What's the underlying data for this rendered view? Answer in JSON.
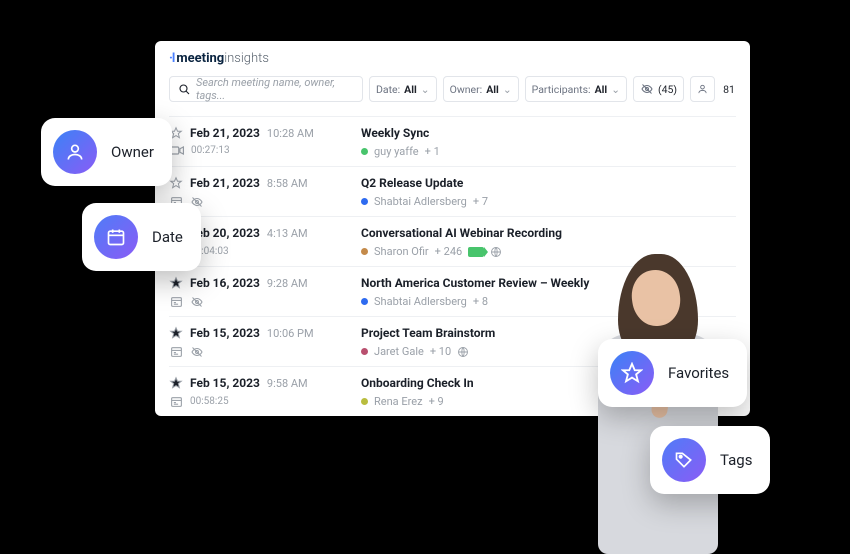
{
  "brand": {
    "mark": "·l",
    "strong": "meeting",
    "light": "insights"
  },
  "search": {
    "placeholder": "Search meeting name, owner, tags..."
  },
  "filters": {
    "date_label": "Date:",
    "date_value": "All",
    "owner_label": "Owner:",
    "owner_value": "All",
    "participants_label": "Participants:",
    "participants_value": "All",
    "hidden_count": "(45)",
    "total": "81"
  },
  "callouts": {
    "owner": "Owner",
    "date": "Date",
    "favorites": "Favorites",
    "tags": "Tags"
  },
  "rows": [
    {
      "date": "Feb 21, 2023",
      "time": "10:28 AM",
      "title": "Weekly Sync",
      "owner": "guy yaffe",
      "plus": "+ 1",
      "duration": "00:27:13",
      "dot": "#48c46c",
      "starred": false,
      "mode": "rec",
      "hidden": false,
      "tag": false,
      "globe": false
    },
    {
      "date": "Feb 21, 2023",
      "time": "8:58 AM",
      "title": "Q2 Release Update",
      "owner": "Shabtai Adlersberg",
      "plus": "+ 7",
      "duration": "",
      "dot": "#2e6bf0",
      "starred": false,
      "mode": "cal",
      "hidden": true,
      "tag": false,
      "globe": false
    },
    {
      "date": "Feb 20, 2023",
      "time": "4:13 AM",
      "title": "Conversational AI Webinar Recording",
      "owner": "Sharon Ofir",
      "plus": "+ 246",
      "duration": "01:04:03",
      "dot": "#c48a4a",
      "starred": false,
      "mode": "cal",
      "hidden": false,
      "tag": true,
      "globe": true
    },
    {
      "date": "Feb 16, 2023",
      "time": "9:28 AM",
      "title": "North America Customer Review – Weekly",
      "owner": "Shabtai Adlersberg",
      "plus": "+ 8",
      "duration": "",
      "dot": "#2e6bf0",
      "starred": true,
      "mode": "cal",
      "hidden": true,
      "tag": false,
      "globe": false
    },
    {
      "date": "Feb 15, 2023",
      "time": "10:06 PM",
      "title": "Project Team Brainstorm",
      "owner": "Jaret Gale",
      "plus": "+ 10",
      "duration": "",
      "dot": "#b9506f",
      "starred": true,
      "mode": "cal",
      "hidden": true,
      "tag": false,
      "globe": true
    },
    {
      "date": "Feb 15, 2023",
      "time": "9:58 AM",
      "title": "Onboarding Check In",
      "owner": "Rena Erez",
      "plus": "+ 9",
      "duration": "00:58:25",
      "dot": "#b9bd3f",
      "starred": true,
      "mode": "cal",
      "hidden": false,
      "tag": false,
      "globe": false
    }
  ]
}
